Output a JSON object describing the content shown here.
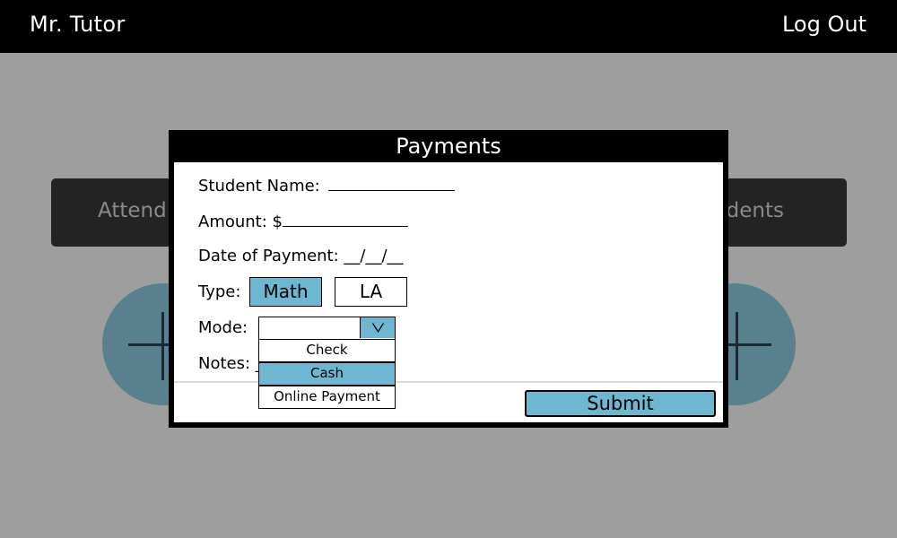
{
  "header": {
    "brand": "Mr. Tutor",
    "logout_label": "Log Out"
  },
  "background": {
    "left_button_text": "Attend",
    "right_button_text": "dents"
  },
  "modal": {
    "title": "Payments",
    "student_name_label": "Student Name:",
    "amount_label": "Amount: $",
    "date_label": "Date of Payment: __/__/__",
    "type_label": "Type:",
    "type_options": [
      "Math",
      "LA"
    ],
    "type_selected": "Math",
    "mode_label": "Mode:",
    "mode_options": [
      "Check",
      "Cash",
      "Online Payment"
    ],
    "mode_highlighted": "Cash",
    "notes_label": "Notes: _",
    "submit_label": "Submit"
  },
  "colors": {
    "accent": "#6fb6d1",
    "topbar": "#000000",
    "overlay": "#9e9e9e",
    "circle": "#59808f"
  },
  "icons": {
    "dropdown": "chevron-down-icon",
    "add": "plus-icon"
  }
}
